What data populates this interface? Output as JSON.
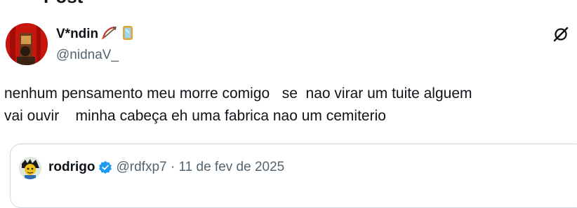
{
  "page": {
    "header_title": "Post"
  },
  "post": {
    "display_name": "V*ndin",
    "handle": "@nidnaV_",
    "text_line1": "nenhum pensamento meu morre comigo   se  nao virar um tuite alguem",
    "text_line2": "vai ouvir    minha cabeça eh uma fabrica nao um cemiterio",
    "icons": [
      "bow-and-arrow-emoji",
      "mirror-emoji",
      "grok-icon"
    ]
  },
  "quoted_post": {
    "display_name": "rodrigo",
    "handle": "@rdfxp7",
    "separator": " · ",
    "date": "11 de fev de 2025",
    "icons": [
      "verified-badge-icon"
    ]
  },
  "colors": {
    "text": "#0f1419",
    "secondary": "#536471",
    "verified": "#1d9bf0",
    "border": "#cfd9de",
    "avatar_red": "#c8160f"
  }
}
